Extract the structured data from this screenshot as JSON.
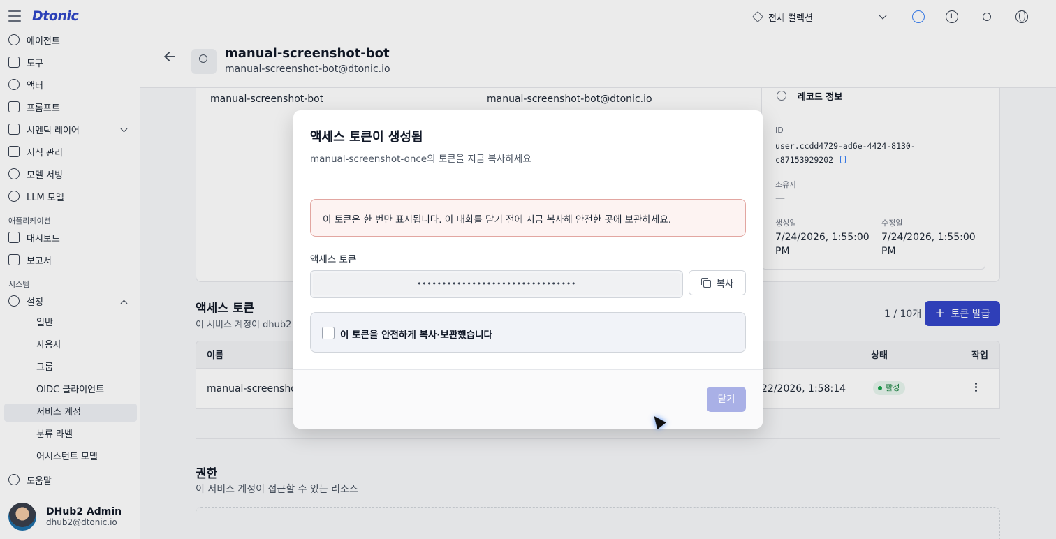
{
  "topbar": {
    "logo": "Dtonic",
    "collection_label": "전체 컬렉션",
    "icons": [
      "menu-icon",
      "cube-icon",
      "chevron-down-icon",
      "kubernetes-icon",
      "info-icon",
      "sun-icon",
      "globe-icon"
    ]
  },
  "sidebar": {
    "items": [
      {
        "label": "에이전트",
        "icon": "agent-icon"
      },
      {
        "label": "도구",
        "icon": "wrench-icon"
      },
      {
        "label": "액터",
        "icon": "user-cog-icon"
      },
      {
        "label": "프롬프트",
        "icon": "document-icon"
      },
      {
        "label": "시멘틱 레이어",
        "icon": "layers-icon"
      },
      {
        "label": "지식 관리",
        "icon": "book-icon"
      },
      {
        "label": "모델 서빙",
        "icon": "gear-icon"
      },
      {
        "label": "LLM 모델",
        "icon": "openai-icon"
      }
    ],
    "section_apps": "애플리케이션",
    "app_items": [
      {
        "label": "대시보드",
        "icon": "dashboard-icon"
      },
      {
        "label": "보고서",
        "icon": "report-icon"
      }
    ],
    "section_system": "시스템",
    "settings_label": "설정",
    "settings_sub": [
      "일반",
      "사용자",
      "그룹",
      "OIDC 클라이언트",
      "서비스 계정",
      "분류 라벨",
      "어시스턴트 모델"
    ],
    "help_label": "도움말",
    "user": {
      "name": "DHub2 Admin",
      "email": "dhub2@dtonic.io"
    }
  },
  "header": {
    "title": "manual-screenshot-bot",
    "subtitle": "manual-screenshot-bot@dtonic.io"
  },
  "info": {
    "name_value": "manual-screenshot-bot",
    "email_value": "manual-screenshot-bot@dtonic.io",
    "record_title": "레코드 정보",
    "id_label": "ID",
    "id_value_line1": "user.ccdd4729-ad6e-4424-8130-",
    "id_value_line2": "c87153929202",
    "owner_label": "소유자",
    "owner_value": "—",
    "created_label": "생성일",
    "created_value": "7/24/2026, 1:55:00 PM",
    "modified_label": "수정일",
    "modified_value": "7/24/2026, 1:55:00 PM"
  },
  "tokens": {
    "title": "액세스 토큰",
    "subtitle": "이 서비스 계정이 dhub2",
    "count": "1 / 10개",
    "issue_label": "토큰 발급",
    "columns": {
      "name": "이름",
      "status": "상태",
      "action": "작업"
    },
    "row": {
      "name": "manual-screensho",
      "date": "22/2026, 1:58:14",
      "status": "활성"
    }
  },
  "permissions": {
    "title": "권한",
    "subtitle": "이 서비스 계정이 접근할 수 있는 리소스"
  },
  "modal": {
    "title": "액세스 토큰이 생성됨",
    "subtitle": "manual-screenshot-once의 토큰을 지금 복사하세요",
    "alert": "이 토큰은 한 번만 표시됩니다. 이 대화를 닫기 전에 지금 복사해 안전한 곳에 보관하세요.",
    "field_label": "액세스 토큰",
    "token_masked": "••••••••••••••••••••••••••••••••",
    "copy_label": "복사",
    "confirm_label": "이 토큰을 안전하게 복사·보관했습니다",
    "confirm_checked": false,
    "close_label": "닫기"
  },
  "colors": {
    "accent": "#3445c8",
    "alert_bg": "#fdf3f2",
    "alert_border": "#e2a6a1",
    "disabled_btn": "#a9b0e6"
  }
}
